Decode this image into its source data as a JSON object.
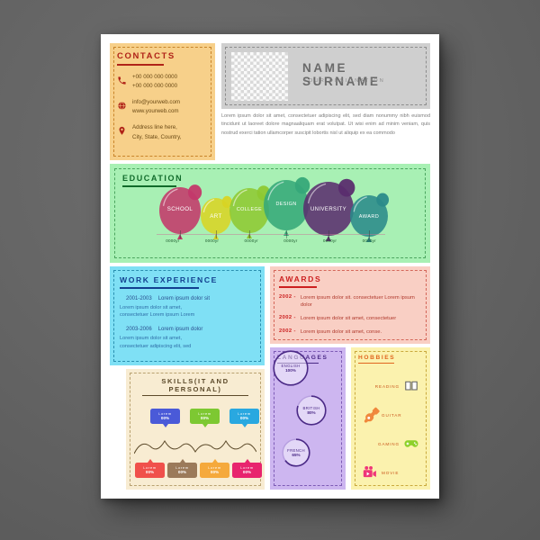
{
  "contacts": {
    "heading": "CONTACTS",
    "rows": [
      {
        "icon": "phone-icon",
        "lines": [
          "+00 000 000 0000",
          "+00 000 000 0000"
        ]
      },
      {
        "icon": "globe-icon",
        "lines": [
          "info@yourweb.com",
          "www.yourweb.com"
        ]
      },
      {
        "icon": "location-pin-icon",
        "lines": [
          "Address line here,",
          "City, State, Country,"
        ]
      }
    ]
  },
  "header": {
    "name": "NAME SURNAME",
    "designation": "YOUR DESIGNATION",
    "photo_placeholder": "photo-placeholder"
  },
  "about": {
    "text": "Lorem ipsum dolor sit amet, consectetuer adipiscing elit, sed diam nonummy nibh euismod tincidunt ut laoreet dolore magnaaliquam erat volutpat. Ut wisi enim ad minim veniam, quis nostrud exerci tation ullamcorper suscipit lobortis nisl ut aliquip ex ea commodo"
  },
  "education": {
    "heading": "EDUCATION",
    "items": [
      {
        "label": "SCHOOL",
        "year": "0000yr",
        "color": "#c3386a"
      },
      {
        "label": "ART",
        "year": "0000yr",
        "color": "#d8d424"
      },
      {
        "label": "COLLEGE",
        "year": "0000yr",
        "color": "#8ec832"
      },
      {
        "label": "DESIGN",
        "year": "0000yr",
        "color": "#36a879"
      },
      {
        "label": "UNIVERSITY",
        "year": "0000yr",
        "color": "#5a2d6e"
      },
      {
        "label": "AWARD",
        "year": "0000yr",
        "color": "#2a8a8a"
      }
    ]
  },
  "work": {
    "heading": "WORK EXPERIENCE",
    "jobs": [
      {
        "period": "2001-2003",
        "title": "Lorem ipsum dolor sit",
        "desc1": "Lorem ipsum dolor sit amet,",
        "desc2": "consectetuer Lorem ipsum Lorem"
      },
      {
        "period": "2003-2006",
        "title": "Lorem ipsum dolor",
        "desc1": "Lorem ipsum dolor sit amet,",
        "desc2": "consectetuer adipiscing elit, sed"
      }
    ]
  },
  "awards": {
    "heading": "AWARDS",
    "items": [
      {
        "year": "2002 -",
        "text": "Lorem ipsum dolor sit. consectetuer Lorem ipsum dolor"
      },
      {
        "year": "2002 -",
        "text": "Lorem ipsum dolor sit amet, consectetuer"
      },
      {
        "year": "2002 -",
        "text": "Lorem ipsum dolor sit amet, conse."
      }
    ]
  },
  "skills": {
    "heading": "SKILLS(IT AND PERSONAL)",
    "top": [
      {
        "label": "Lorem",
        "value": "00%",
        "color": "#4a5ad8"
      },
      {
        "label": "Lorem",
        "value": "00%",
        "color": "#7dc832"
      },
      {
        "label": "Lorem",
        "value": "00%",
        "color": "#29a8e0"
      }
    ],
    "bottom": [
      {
        "label": "Lorem",
        "value": "00%",
        "color": "#f0504b"
      },
      {
        "label": "Lorem",
        "value": "00%",
        "color": "#9b7a5a"
      },
      {
        "label": "Lorem",
        "value": "00%",
        "color": "#f5a93c"
      },
      {
        "label": "Lorem",
        "value": "00%",
        "color": "#e8246e"
      }
    ]
  },
  "languages": {
    "heading": "LANGUAGES",
    "items": [
      {
        "name": "ENGLISH",
        "value": "100%",
        "pct": 100
      },
      {
        "name": "BRITISH",
        "value": "80%",
        "pct": 80
      },
      {
        "name": "FRENCH",
        "value": "65%",
        "pct": 65
      }
    ]
  },
  "hobbies": {
    "heading": "HOBBIES",
    "items": [
      {
        "label": "READING",
        "icon": "book-icon",
        "color": "#5e5e5e"
      },
      {
        "label": "GUITAR",
        "icon": "guitar-icon",
        "color": "#f0883c"
      },
      {
        "label": "GAMING",
        "icon": "gamepad-icon",
        "color": "#8dd02a"
      },
      {
        "label": "MOVIE",
        "icon": "movie-camera-icon",
        "color": "#ef3578"
      }
    ]
  }
}
